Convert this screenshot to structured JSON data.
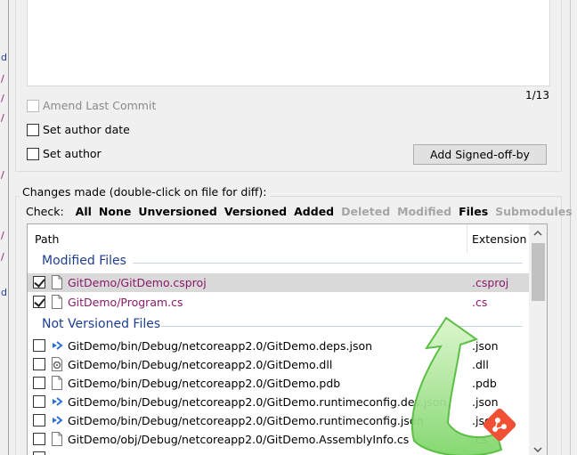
{
  "commit": {
    "counter": "1/13",
    "amend_label": "Amend Last Commit",
    "author_date_label": "Set author date",
    "author_label": "Set author",
    "signoff_button": "Add Signed-off-by"
  },
  "changes": {
    "legend": "Changes made (double-click on file for diff):",
    "check_label": "Check:",
    "options": [
      {
        "label": "All",
        "enabled": true
      },
      {
        "label": "None",
        "enabled": true
      },
      {
        "label": "Unversioned",
        "enabled": true
      },
      {
        "label": "Versioned",
        "enabled": true
      },
      {
        "label": "Added",
        "enabled": true
      },
      {
        "label": "Deleted",
        "enabled": false
      },
      {
        "label": "Modified",
        "enabled": false
      },
      {
        "label": "Files",
        "enabled": true
      },
      {
        "label": "Submodules",
        "enabled": false
      }
    ],
    "columns": {
      "path": "Path",
      "extension": "Extension"
    },
    "groups": {
      "modified": "Modified Files",
      "not_versioned": "Not Versioned Files"
    },
    "modified_files": [
      {
        "name": "GitDemo/GitDemo.csproj",
        "ext": ".csproj",
        "checked": true,
        "selected": true,
        "icon": "file-icon"
      },
      {
        "name": "GitDemo/Program.cs",
        "ext": ".cs",
        "checked": true,
        "selected": false,
        "icon": "file-icon"
      }
    ],
    "unversioned_files": [
      {
        "name": "GitDemo/bin/Debug/netcoreapp2.0/GitDemo.deps.json",
        "ext": ".json",
        "checked": false,
        "icon": "json-icon"
      },
      {
        "name": "GitDemo/bin/Debug/netcoreapp2.0/GitDemo.dll",
        "ext": ".dll",
        "checked": false,
        "icon": "dll-icon"
      },
      {
        "name": "GitDemo/bin/Debug/netcoreapp2.0/GitDemo.pdb",
        "ext": ".pdb",
        "checked": false,
        "icon": "file-icon"
      },
      {
        "name": "GitDemo/bin/Debug/netcoreapp2.0/GitDemo.runtimeconfig.dev.json",
        "ext": ".json",
        "checked": false,
        "icon": "json-icon"
      },
      {
        "name": "GitDemo/bin/Debug/netcoreapp2.0/GitDemo.runtimeconfig.json",
        "ext": ".json",
        "checked": false,
        "icon": "json-icon"
      },
      {
        "name": "GitDemo/obj/Debug/netcoreapp2.0/GitDemo.AssemblyInfo.cs",
        "ext": ".cs",
        "checked": false,
        "icon": "file-icon"
      }
    ]
  },
  "colors": {
    "modified_text": "#8b1a6b",
    "group_title": "#1e3e8f",
    "disabled_text": "#a6a6a6"
  }
}
